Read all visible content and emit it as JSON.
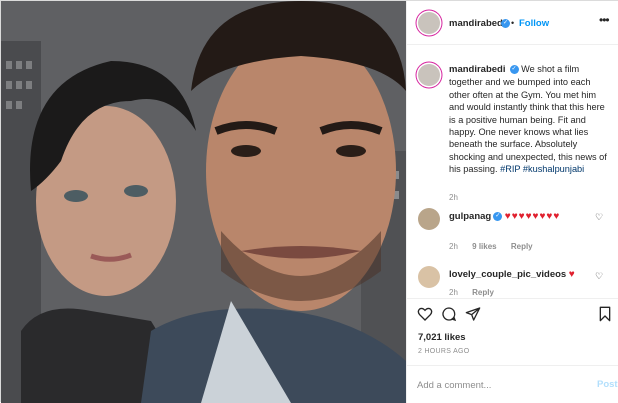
{
  "header": {
    "username": "mandirabedi",
    "separator": "•",
    "follow_label": "Follow",
    "more_icon": "ellipsis-icon"
  },
  "caption": {
    "username": "mandirabedi",
    "text": "We shot a film together and we bumped into each other often at the Gym. You met him and would instantly think that this here is a positive human being. Fit and happy. One never knows what lies beneath the surface. Absolutely shocking and unexpected, this news of his passing.",
    "hashtags": "#RIP #kushalpunjabi",
    "time": "2h"
  },
  "comments": [
    {
      "username": "gulpanag",
      "text": "♥♥♥♥♥♥♥♥",
      "time": "2h",
      "likes": "9 likes",
      "reply_label": "Reply"
    },
    {
      "username": "lovely_couple_pic_videos",
      "text": "♥",
      "time": "2h",
      "reply_label": "Reply"
    }
  ],
  "actions": {
    "icons": [
      "heart-icon",
      "comment-icon",
      "share-icon",
      "bookmark-icon"
    ]
  },
  "likes_count": "7,021 likes",
  "posted_ago": "2 HOURS AGO",
  "add_comment": {
    "placeholder": "Add a comment...",
    "post_label": "Post"
  },
  "colors": {
    "accent": "#0095f6",
    "post_disabled": "#b2dffc",
    "heart_red": "#e0202e",
    "verified_blue": "#3897f0"
  }
}
